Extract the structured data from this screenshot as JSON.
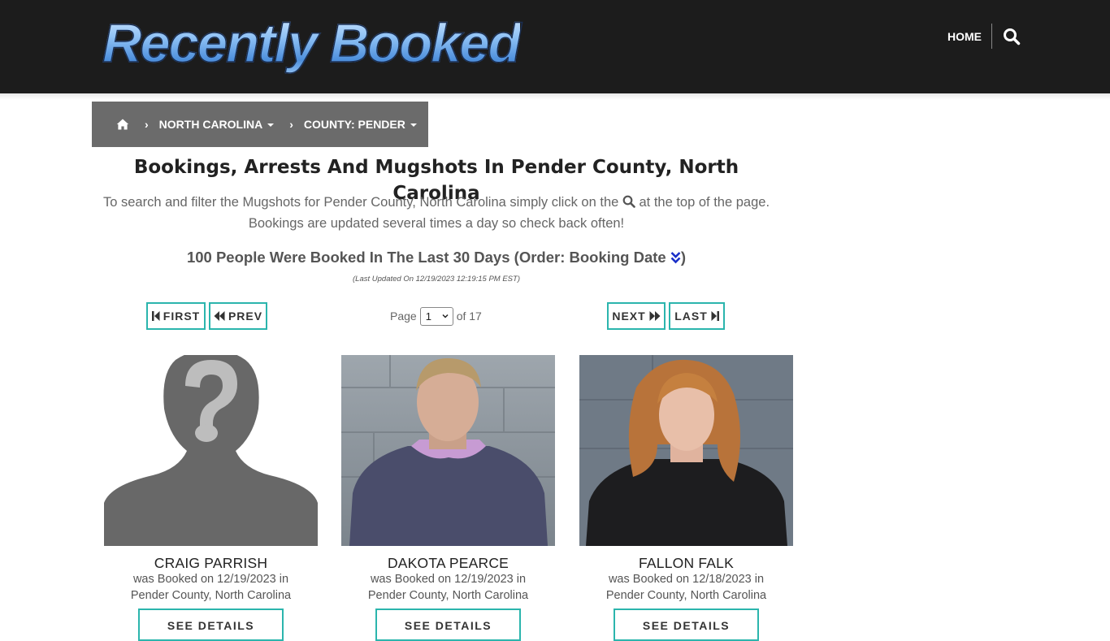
{
  "header": {
    "logo_text": "Recently Booked",
    "nav_home": "HOME",
    "search_icon": "search-icon",
    "brand_blue": "#7fb3f0",
    "bar_color": "#1c1c1c"
  },
  "breadcrumb": {
    "home_icon": "home-icon",
    "state": "NORTH CAROLINA",
    "county": "COUNTY: PENDER"
  },
  "main": {
    "title": "Bookings, Arrests And Mugshots In Pender County, North Carolina",
    "desc_before": "To search and filter the Mugshots for Pender County, North Carolina simply click on the",
    "desc_after": "at the top of the page.",
    "desc_line2": "Bookings are updated several times a day so check back often!",
    "count_text": "100 People Were Booked In The Last 30 Days (Order: Booking Date",
    "count_close": ")",
    "updated": "(Last Updated On 12/19/2023 12:19:15 PM EST)"
  },
  "pagination": {
    "first": "FIRST",
    "prev": "PREV",
    "next": "NEXT",
    "last": "LAST",
    "page_label": "Page",
    "current_page": "1",
    "of_label": "of 17",
    "accent": "#2bb5ad"
  },
  "cards": [
    {
      "name": "CRAIG PARRISH",
      "booked": "was Booked on 12/19/2023 in",
      "location": "Pender County, North Carolina",
      "button": "SEE DETAILS"
    },
    {
      "name": "DAKOTA PEARCE",
      "booked": "was Booked on 12/19/2023 in",
      "location": "Pender County, North Carolina",
      "button": "SEE DETAILS"
    },
    {
      "name": "FALLON FALK",
      "booked": "was Booked on 12/18/2023 in",
      "location": "Pender County, North Carolina",
      "button": "SEE DETAILS"
    }
  ]
}
